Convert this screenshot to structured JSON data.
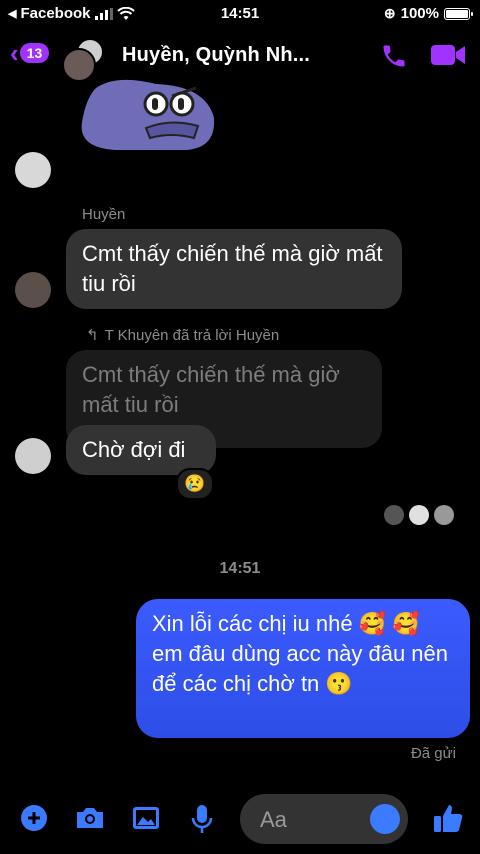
{
  "status_bar": {
    "back_app": "Facebook",
    "time": "14:51",
    "battery": "100%",
    "battery_level": 1.0
  },
  "header": {
    "unread_count": "13",
    "title": "Huyền, Quỳnh Nh..."
  },
  "messages": {
    "sender_name": "Huyền",
    "msg1": "Cmt thấy chiến thế mà giờ mất tiu rồi",
    "reply_label": "T Khuyên đã trả lời Huyền",
    "quoted": "Cmt thấy chiến thế mà giờ mất tiu rồi",
    "reply": "Chờ đợi đi",
    "reaction": "😢",
    "timestamp": "14:51",
    "mine": "Xin lỗi các chị iu nhé 🥰 🥰 em đâu dùng acc này đâu nên để các chị chờ tn 😗",
    "sent_status": "Đã gửi"
  },
  "composer": {
    "placeholder": "Aa"
  },
  "colors": {
    "accent": "#a033ff",
    "my_bubble": "#3b5bff",
    "icon_blue": "#3b7bff",
    "other_bubble": "#333333"
  },
  "icons": [
    "back-chevron-icon",
    "phone-icon",
    "video-icon",
    "plus-icon",
    "camera-icon",
    "image-icon",
    "microphone-icon",
    "emoji-icon",
    "thumbs-up-icon",
    "reply-arrow-icon"
  ]
}
